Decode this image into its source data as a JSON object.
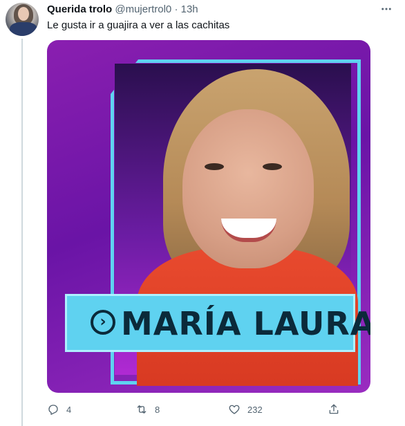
{
  "tweet": {
    "display_name": "Querida trolo",
    "handle": "@mujertrol0",
    "separator": "·",
    "time": "13h",
    "more_icon": "more-horizontal-icon",
    "text": "Le gusta ir a guajira a ver a las cachitas"
  },
  "media": {
    "overlay_name": "MARÍA LAURA",
    "arrow_icon": "chevron-right-circle-icon",
    "colors": {
      "background": "#8a1fb0",
      "frame": "#5fd2f0",
      "name_bar": "#5fd2f0",
      "name_text": "#0b2a3a",
      "jacket": "#e84a2e"
    }
  },
  "actions": {
    "reply": {
      "icon": "reply-icon",
      "count": "4"
    },
    "retweet": {
      "icon": "retweet-icon",
      "count": "8"
    },
    "like": {
      "icon": "heart-icon",
      "count": "232"
    },
    "share": {
      "icon": "share-icon"
    }
  }
}
